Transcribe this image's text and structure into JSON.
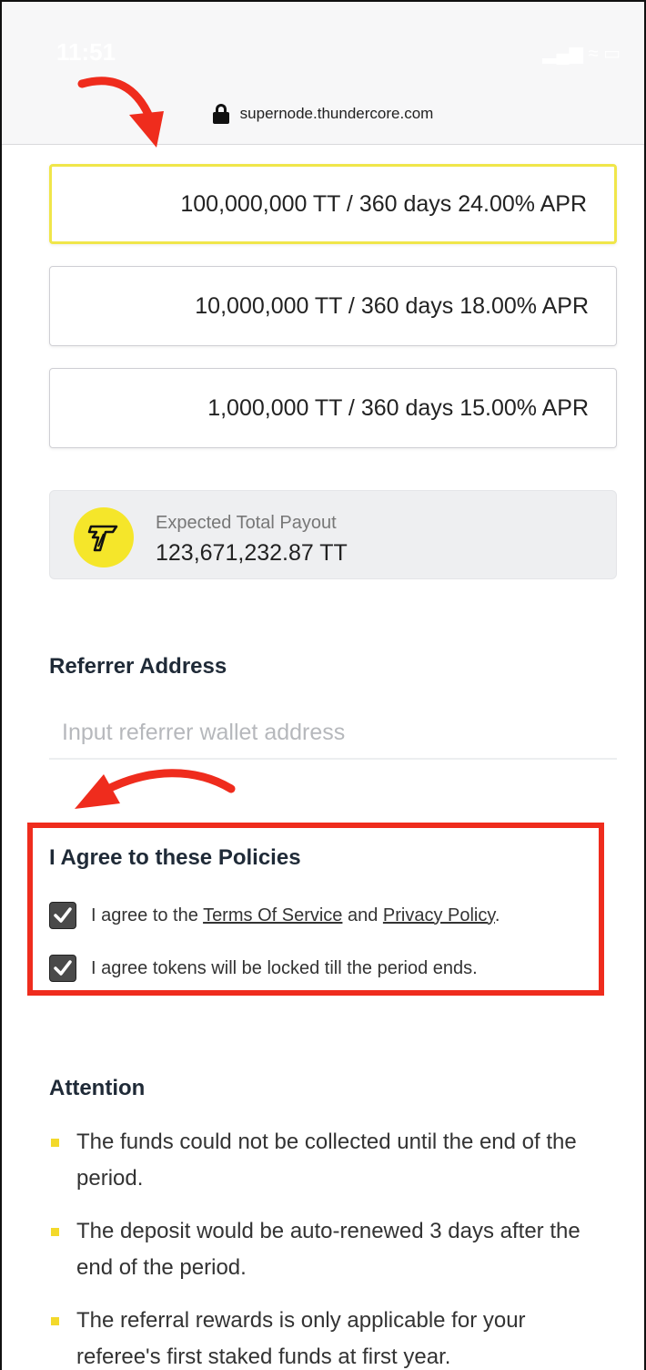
{
  "status_bar": {
    "time": "11:51",
    "icons": "▂▄▆ ≈ ▭"
  },
  "browser": {
    "url": "supernode.thundercore.com"
  },
  "plans": [
    {
      "label": "100,000,000 TT / 360 days 24.00% APR",
      "selected": true
    },
    {
      "label": "10,000,000 TT / 360 days 18.00% APR",
      "selected": false
    },
    {
      "label": "1,000,000 TT / 360 days 15.00% APR",
      "selected": false
    }
  ],
  "payout": {
    "label": "Expected Total Payout",
    "value": "123,671,232.87 TT"
  },
  "referrer": {
    "title": "Referrer Address",
    "placeholder": "Input referrer wallet address",
    "value": ""
  },
  "policies": {
    "title": "I Agree to these Policies",
    "item1": {
      "prefix": "I agree to the ",
      "terms": "Terms Of Service",
      "mid": " and ",
      "privacy": "Privacy Policy",
      "suffix": ".",
      "checked": true
    },
    "item2": {
      "text": "I agree tokens will be locked till the period ends.",
      "checked": true
    }
  },
  "attention": {
    "title": "Attention",
    "items": [
      "The funds could not be collected until the end of the period.",
      "The deposit would be auto-renewed 3 days after the end of the period.",
      "The referral rewards is only applicable for your referee's first staked funds at first year."
    ]
  },
  "colors": {
    "highlight": "#f0e64a",
    "coin": "#f5e62a",
    "annotation_red": "#ef2c1d",
    "bullet": "#f3d92b"
  }
}
